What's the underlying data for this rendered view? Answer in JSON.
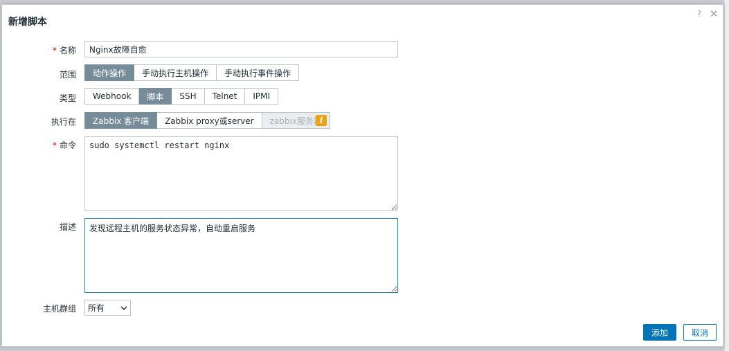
{
  "dialog": {
    "title": "新增脚本",
    "help_glyph": "?",
    "close_glyph": "✕"
  },
  "form": {
    "name": {
      "label": "名称",
      "value": "Nginx故障自愈"
    },
    "scope": {
      "label": "范围",
      "options": [
        "动作操作",
        "手动执行主机操作",
        "手动执行事件操作"
      ],
      "selected": "动作操作"
    },
    "type": {
      "label": "类型",
      "options": [
        "Webhook",
        "脚本",
        "SSH",
        "Telnet",
        "IPMI"
      ],
      "selected": "脚本"
    },
    "execute_on": {
      "label": "执行在",
      "options": [
        "Zabbix 客户端",
        "Zabbix proxy或server",
        "zabbix服务器"
      ],
      "selected": "Zabbix 客户端",
      "disabled": "zabbix服务器",
      "info_glyph": "i"
    },
    "command": {
      "label": "命令",
      "value": "sudo systemctl restart nginx"
    },
    "description": {
      "label": "描述",
      "value": "发现远程主机的服务状态异常，自动重启服务"
    },
    "host_group": {
      "label": "主机群组",
      "value": "所有"
    },
    "required_mark": "*"
  },
  "footer": {
    "add_label": "添加",
    "cancel_label": "取消"
  },
  "colors": {
    "primary": "#0275b8",
    "segment_active": "#768d99",
    "info": "#e8a317",
    "required": "#d40000"
  }
}
